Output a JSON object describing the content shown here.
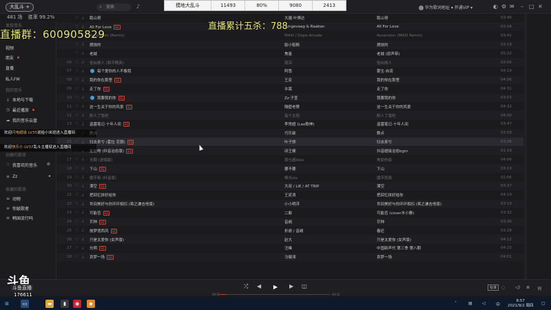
{
  "topbar": {
    "stream_tag": "大乱斗 +",
    "search_placeholder": "搜索",
    "user_name": "华为歌词地址 ▾",
    "vip": "开通VIP ▾",
    "stats_a": "481 场",
    "stats_b": "胜率 99.2%"
  },
  "scorebar": [
    "模地大乱斗",
    "11493",
    "80%",
    "9080",
    "2413"
  ],
  "overlay": {
    "group": "直播群：600905829",
    "kills": "直播累计五杀：788"
  },
  "sidebar": {
    "items": [
      {
        "label": "发现音乐",
        "head": true,
        "icon": ""
      },
      {
        "label": "视频",
        "icon": ""
      },
      {
        "label": "朋友",
        "icon": "",
        "dot": true
      },
      {
        "label": "直播",
        "icon": ""
      },
      {
        "label": "私人FM",
        "icon": ""
      },
      {
        "label": "我的音乐",
        "head": true,
        "icon": ""
      },
      {
        "label": "本地与下载",
        "icon": "⤓"
      },
      {
        "label": "最近播放",
        "icon": "◷",
        "dot": true
      },
      {
        "label": "我的音乐云盘",
        "icon": "☁"
      },
      {
        "label": "创建的歌单",
        "head": true,
        "icon": ""
      },
      {
        "label": "我喜欢的音乐",
        "icon": "♡",
        "right": "⚙"
      },
      {
        "label": "Zz",
        "icon": "≡",
        "right": "◂"
      },
      {
        "label": "收藏的歌单",
        "head": true,
        "icon": ""
      },
      {
        "label": "动物",
        "icon": "≡"
      },
      {
        "label": "你敲歌者",
        "icon": "≡"
      },
      {
        "label": "韩国流行吗",
        "icon": "≡"
      }
    ]
  },
  "chat": [
    {
      "pre": "欢迎",
      "name": "闪电超级 LV35",
      "post": "说给小米班进入直播间"
    },
    {
      "pre": "欢迎",
      "name": "快乐小 LV37",
      "post": "乱斗主播就进入直播间"
    }
  ],
  "songs": [
    {
      "num": "",
      "title": "跑山哥",
      "tag": "",
      "artist": "大疆·叶博达",
      "album": "跑山哥",
      "dur": "03:46"
    },
    {
      "num": "",
      "title": "All For Love",
      "tag": "SQ",
      "artist": "Tungevaag & Raaban",
      "album": "All For Love",
      "dur": "03:24"
    },
    {
      "num": "03",
      "title": "Ascension (Remix)",
      "tag": "",
      "artist": "MAXI / Dope Arcade",
      "album": "Ascension (MAXI Remix)",
      "dur": "03:41",
      "dim": true
    },
    {
      "num": "",
      "title": "燃烧的",
      "tag": "",
      "artist": "励小稻枫",
      "album": "燃烧的",
      "dur": "03:19"
    },
    {
      "num": "",
      "title": "老城",
      "tag": "",
      "artist": "焦曼",
      "album": "老城 (原声带)",
      "dur": "05:22"
    },
    {
      "num": "06",
      "title": "恰似故人 (和平精英)",
      "tag": "",
      "artist": "周深",
      "album": "恰似故人",
      "dur": "03:56",
      "dim": true
    },
    {
      "num": "07",
      "title": "每个爱你的人不像我",
      "tag": "",
      "artist": "阿悠",
      "album": "雾生·自流",
      "dur": "04:10",
      "blue": true
    },
    {
      "num": "08",
      "title": "我的你在那里",
      "tag": "SQ",
      "artist": "王宏",
      "album": "我的你在那里",
      "dur": "04:06"
    },
    {
      "num": "09",
      "title": "走了你",
      "tag": "SQ",
      "artist": "许嵩",
      "album": "走了你",
      "dur": "04:31"
    },
    {
      "num": "10",
      "title": "我要我的你",
      "tag": "SQ",
      "artist": "Zz·子宣",
      "album": "我要我的你",
      "dur": "03:03",
      "blue": true
    },
    {
      "num": "11",
      "title": "这一生关于你的风景",
      "tag": "SQ",
      "artist": "隔壁老樊",
      "album": "这一生关于你的风景",
      "dur": "04:32"
    },
    {
      "num": "12",
      "title": "醉人了我吧",
      "tag": "",
      "artist": "每个太阳",
      "album": "醉人了我吧",
      "dur": "04:00",
      "dim": true
    },
    {
      "num": "13",
      "title": "盗墓笔记·十年人间",
      "tag": "SQ",
      "artist": "李常超 (Lao歌神)",
      "album": "盗墓笔记·十年人间",
      "dur": "03:47"
    },
    {
      "num": "14",
      "title": "数点",
      "tag": "",
      "artist": "巧乐兹",
      "album": "数点",
      "dur": "03:59"
    },
    {
      "num": "15",
      "title": "归去来兮 (霍拉 花朝)",
      "tag": "SQ",
      "artist": "叶子馋",
      "album": "归去来兮",
      "dur": "03:26",
      "sel": true
    },
    {
      "num": "16",
      "title": "处处吻 (抖音治愈版)",
      "tag": "SQ",
      "artist": "邱王健",
      "album": "抖音超级治愈bgm",
      "dur": "01:19"
    },
    {
      "num": "17",
      "title": "无期 (说唱版)",
      "tag": "",
      "artist": "周乜超Alex",
      "album": "美丽伤痕",
      "dur": "04:06",
      "dim": true
    },
    {
      "num": "18",
      "title": "下山",
      "tag": "SQ",
      "artist": "要不要",
      "album": "下山",
      "dur": "03:13"
    },
    {
      "num": "19",
      "title": "魔芋爽 (抖音版)",
      "tag": "",
      "artist": "棒光zie",
      "album": "魔芋雨爽",
      "dur": "02:56",
      "dim": true
    },
    {
      "num": "20",
      "title": "漂空",
      "tag": "SQ",
      "artist": "大叔 / LiE / AT TRIP",
      "album": "漂空",
      "dur": "03:37"
    },
    {
      "num": "21",
      "title": "把回忆拼好给你",
      "tag": "",
      "artist": "王贰浪",
      "album": "把回忆拼好给你",
      "dur": "04:19"
    },
    {
      "num": "22",
      "title": "世间美好与你环环相扣 (蒋之谦吉他版)",
      "tag": "",
      "artist": "小小明浮",
      "album": "世间美好与你环环相扣 (蒋之谦吉他版)",
      "dur": "03:19"
    },
    {
      "num": "23",
      "title": "可能否",
      "tag": "SQ",
      "artist": "二敢",
      "album": "可能否 (cover木小雅)",
      "dur": "03:32"
    },
    {
      "num": "24",
      "title": "芒种",
      "tag": "SQ",
      "artist": "音阙",
      "album": "芒种",
      "dur": "03:36"
    },
    {
      "num": "25",
      "title": "故梦俏西风",
      "tag": "SQ",
      "artist": "折谢 / 音阙",
      "album": "春还",
      "dur": "03:28"
    },
    {
      "num": "26",
      "title": "只是太爱你 (女声版)",
      "tag": "",
      "artist": "赵大",
      "album": "只是太爱你 (女声版)",
      "dur": "04:12"
    },
    {
      "num": "27",
      "title": "光明",
      "tag": "SQ",
      "artist": "汪峰",
      "album": "中国新声代 第三季 第八期",
      "dur": "04:23"
    },
    {
      "num": "28",
      "title": "哀梦一场",
      "tag": "SQ",
      "artist": "马健涛",
      "album": "哀梦一场",
      "dur": "04:01"
    }
  ],
  "player": {
    "elapsed": "00:00",
    "total": "04:31",
    "progress": 0.05,
    "lyrics_label": "标准"
  },
  "brand": {
    "logo": "斗鱼",
    "sub": "斗鱼直播",
    "room_id": "176611"
  },
  "taskbar": {
    "time": "8:57",
    "date": "2021/9/2 周四"
  }
}
